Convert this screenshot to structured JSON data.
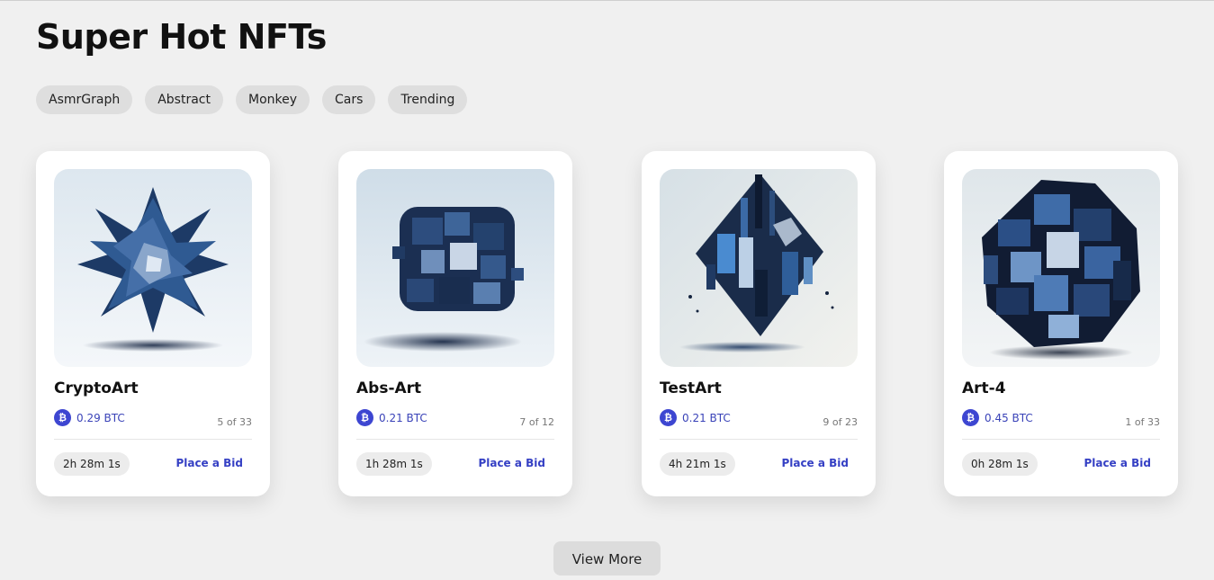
{
  "section": {
    "title": "Super Hot NFTs",
    "tags": [
      "AsmrGraph",
      "Abstract",
      "Monkey",
      "Cars",
      "Trending"
    ]
  },
  "colors": {
    "background": "#f0f0f0",
    "accent": "#3540c4",
    "btc_badge": "#3d46d1"
  },
  "cards": [
    {
      "name": "CryptoArt",
      "currency_icon": "bitcoin-icon",
      "price": "0.29 BTC",
      "edition": "5 of 33",
      "timer": "2h 28m 1s",
      "bid_label": "Place a Bid"
    },
    {
      "name": "Abs-Art",
      "currency_icon": "bitcoin-icon",
      "price": "0.21 BTC",
      "edition": "7 of 12",
      "timer": "1h 28m 1s",
      "bid_label": "Place a Bid"
    },
    {
      "name": "TestArt",
      "currency_icon": "bitcoin-icon",
      "price": "0.21 BTC",
      "edition": "9 of 23",
      "timer": "4h 21m 1s",
      "bid_label": "Place a Bid"
    },
    {
      "name": "Art-4",
      "currency_icon": "bitcoin-icon",
      "price": "0.45 BTC",
      "edition": "1 of 33",
      "timer": "0h 28m 1s",
      "bid_label": "Place a Bid"
    }
  ],
  "view_more_label": "View More"
}
